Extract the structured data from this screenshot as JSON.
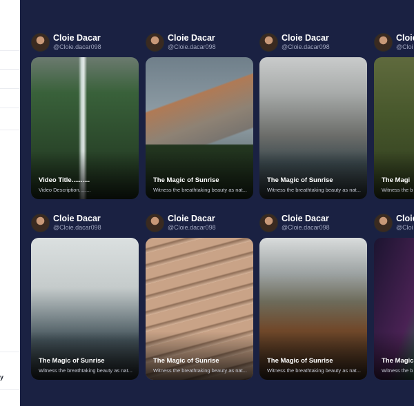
{
  "sidebar": {
    "fragment_text": "y"
  },
  "feed": [
    {
      "author_name": "Cloie Dacar",
      "handle": "@Cloie.dacar098",
      "title": "Video Title..........",
      "description": "Video Description........",
      "scene": "waterfall-forest"
    },
    {
      "author_name": "Cloie Dacar",
      "handle": "@Cloie.dacar098",
      "title": "The Magic of Sunrise",
      "description": "Witness the breathtaking beauty as nat...",
      "scene": "granite-mountain"
    },
    {
      "author_name": "Cloie Dacar",
      "handle": "@Cloie.dacar098",
      "title": "The Magic of Sunrise",
      "description": "Witness the breathtaking beauty as nat...",
      "scene": "misty-canyon"
    },
    {
      "author_name": "Cloie",
      "handle": "@Cloi",
      "title": "The Magi",
      "description": "Witness the b",
      "scene": "forest-branches"
    },
    {
      "author_name": "Cloie Dacar",
      "handle": "@Cloie.dacar098",
      "title": "The Magic of Sunrise",
      "description": "Witness the breathtaking beauty as nat...",
      "scene": "sea-waves"
    },
    {
      "author_name": "Cloie Dacar",
      "handle": "@Cloie.dacar098",
      "title": "The Magic of Sunrise",
      "description": "Witness the breathtaking beauty as nat...",
      "scene": "desert-dunes"
    },
    {
      "author_name": "Cloie Dacar",
      "handle": "@Cloie.dacar098",
      "title": "The Magic of Sunrise",
      "description": "Witness the breathtaking beauty as nat...",
      "scene": "autumn-mountains"
    },
    {
      "author_name": "Cloie",
      "handle": "@Cloi",
      "title": "The Magic",
      "description": "Witness the b",
      "scene": "aurora"
    }
  ],
  "colors": {
    "main_background": "#1a2142",
    "sidebar_background": "#ffffff",
    "text_primary": "#ffffff",
    "text_secondary": "#9ea4bd"
  }
}
